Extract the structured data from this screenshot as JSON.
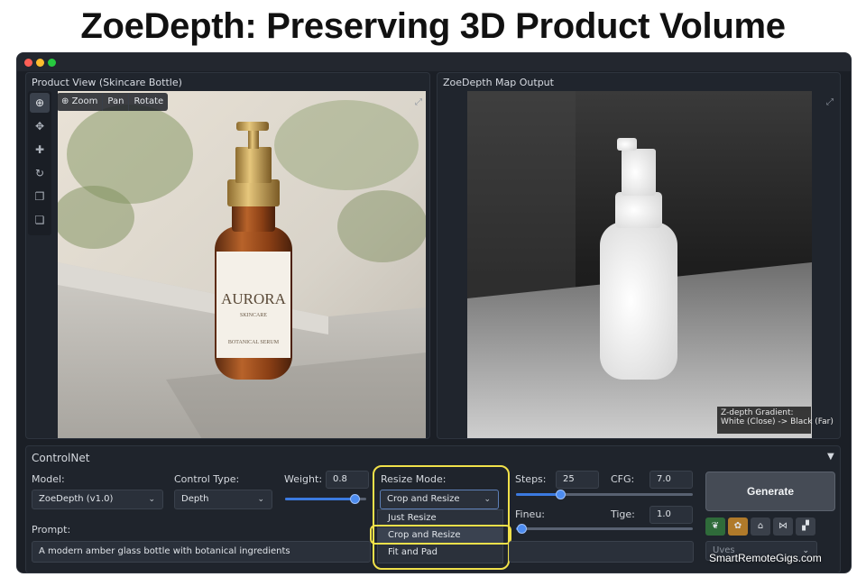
{
  "headline": "ZoeDepth: Preserving 3D Product Volume",
  "window": {
    "controls": {
      "close_color": "#ff5f56",
      "minimize_color": "#ffbd2e",
      "maximize_color": "#27c93f"
    }
  },
  "left_panel": {
    "title": "Product View (Skincare Bottle)",
    "viewer_toolbar": {
      "zoom": "Zoom",
      "pan": "Pan",
      "rotate": "Rotate"
    },
    "tools": [
      "zoom-icon",
      "move-icon",
      "crosshair-icon",
      "rotate-icon",
      "copy-icon",
      "layers-icon"
    ],
    "bottle_label": {
      "brand": "AURORA",
      "sub": "SKINCARE",
      "product": "BOTANICAL SERUM"
    }
  },
  "right_panel": {
    "title": "ZoeDepth Map Output",
    "legend_line1": "Z-depth Gradient:",
    "legend_line2": "White (Close) -> Black (Far)"
  },
  "controlnet": {
    "section_title": "ControlNet",
    "collapse_glyph": "▼",
    "model": {
      "label": "Model:",
      "value": "ZoeDepth (v1.0)"
    },
    "control_type": {
      "label": "Control Type:",
      "value": "Depth"
    },
    "weight": {
      "label": "Weight:",
      "value": "0.8",
      "fraction": 0.85
    },
    "resize_mode": {
      "label": "Resize Mode:",
      "value": "Crop and Resize",
      "options": [
        "Just Resize",
        "Crop and Resize",
        "Fit and Pad"
      ]
    },
    "steps": {
      "label": "Steps:",
      "value": "25",
      "fraction": 0.25
    },
    "cfg": {
      "label": "CFG:",
      "value": "7.0"
    },
    "fineu": {
      "label": "Fineu:"
    },
    "tige": {
      "label": "Tige:",
      "value": "1.0"
    },
    "fine_slider_fraction": 0.03,
    "prompt": {
      "label": "Prompt:",
      "value": "A modern amber glass bottle with botanical ingredients"
    },
    "generate": "Generate",
    "mini_select": "Uves",
    "quick_icons": [
      "leaf-icon",
      "palette-icon",
      "save-icon",
      "share-icon",
      "chart-icon"
    ]
  },
  "highlight_color": "#f1e14a",
  "watermark": "SmartRemoteGigs.com"
}
